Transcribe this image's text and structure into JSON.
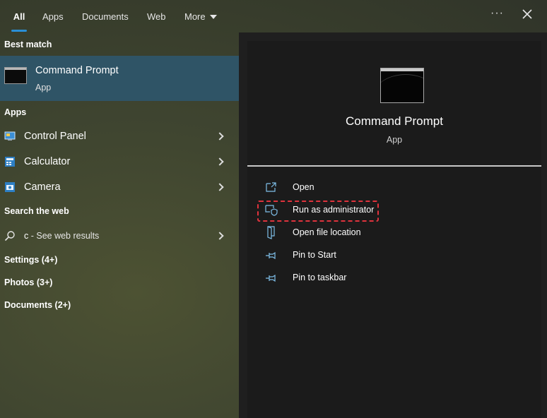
{
  "tabs": [
    {
      "label": "All",
      "active": true
    },
    {
      "label": "Apps"
    },
    {
      "label": "Documents"
    },
    {
      "label": "Web"
    },
    {
      "label": "More"
    }
  ],
  "sections": {
    "best_match": "Best match",
    "apps": "Apps",
    "search_web": "Search the web",
    "settings": "Settings (4+)",
    "photos": "Photos (3+)",
    "documents": "Documents (2+)"
  },
  "best_match": {
    "title": "Command Prompt",
    "subtitle": "App",
    "icon": "command-prompt-icon"
  },
  "apps": [
    {
      "label": "Control Panel",
      "icon": "control-panel-icon"
    },
    {
      "label": "Calculator",
      "icon": "calculator-icon"
    },
    {
      "label": "Camera",
      "icon": "camera-icon"
    }
  ],
  "web_search": {
    "query": "c",
    "suffix": " - See web results",
    "icon": "search-icon"
  },
  "detail": {
    "title": "Command Prompt",
    "subtitle": "App",
    "actions": [
      {
        "label": "Open",
        "icon": "open-icon"
      },
      {
        "label": "Run as administrator",
        "icon": "shield-icon",
        "highlighted": true
      },
      {
        "label": "Open file location",
        "icon": "folder-icon"
      },
      {
        "label": "Pin to Start",
        "icon": "pin-icon"
      },
      {
        "label": "Pin to taskbar",
        "icon": "pin-icon"
      }
    ]
  },
  "colors": {
    "selected_row": "#2f5466",
    "accent": "#2a8fd6",
    "highlight_border": "#e0333d",
    "pane_bg": "#1b1b1b"
  }
}
